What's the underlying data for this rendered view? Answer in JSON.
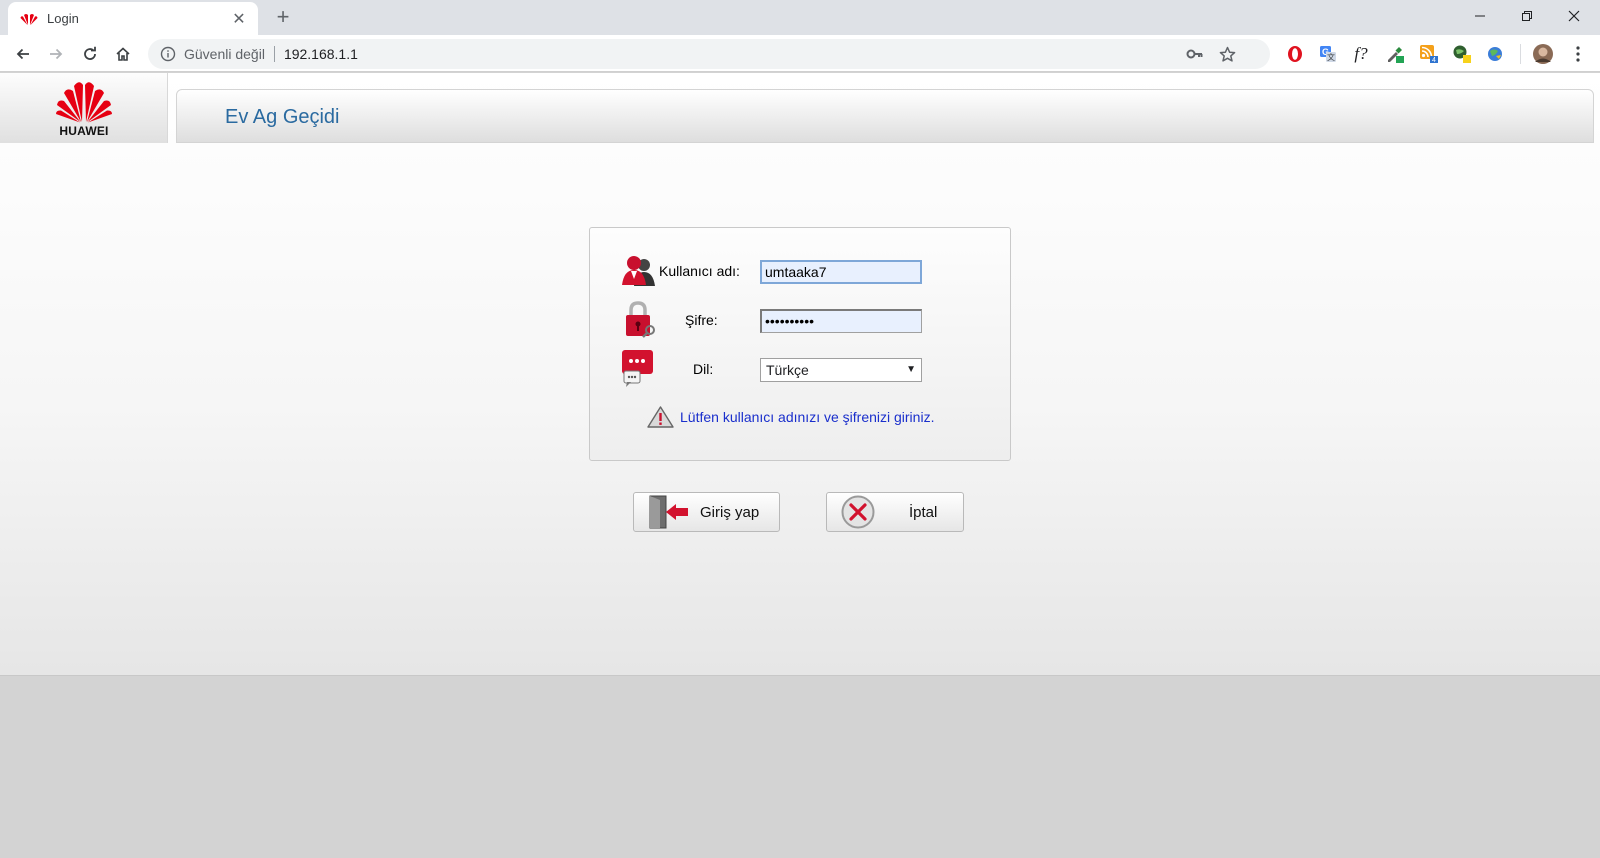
{
  "browser": {
    "tab_title": "Login",
    "security_label": "Güvenli değil",
    "url": "192.168.1.1"
  },
  "header": {
    "brand": "HUAWEI",
    "title": "Ev Ag Geçidi"
  },
  "login": {
    "username_label": "Kullanıcı adı:",
    "username_value": "umtaaka7",
    "password_label": "Şifre:",
    "password_value": "••••••••••",
    "language_label": "Dil:",
    "language_value": "Türkçe",
    "notice": "Lütfen kullanıcı adınızı ve şifrenizi giriniz."
  },
  "buttons": {
    "login_label": "Giriş yap",
    "cancel_label": "İptal"
  },
  "colors": {
    "brand_red": "#e60012",
    "header_title": "#2a6aa0",
    "notice_text": "#1a2fcc"
  }
}
